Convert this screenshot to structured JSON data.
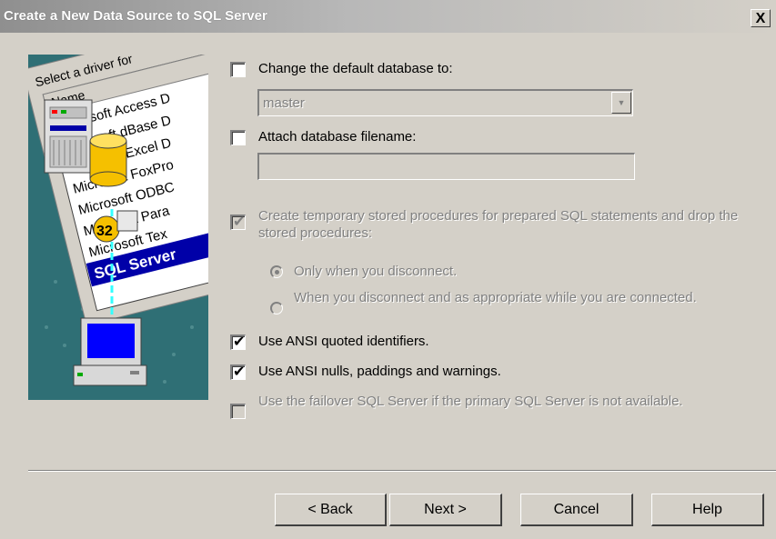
{
  "window": {
    "title": "Create a New Data Source to SQL Server",
    "close_label": "X"
  },
  "illustration": {
    "header_text": "Select a driver for",
    "column_label": "Name",
    "drivers": [
      "Microsoft Access D",
      "Microsoft dBase D",
      "Microsoft Excel D",
      "Microsoft FoxPro",
      "Microsoft ODBC",
      "Microsoft Para",
      "Microsoft Tex",
      "SQL Server"
    ],
    "badge": "32"
  },
  "options": {
    "change_default_db": {
      "label": "Change the default database to:",
      "checked": false
    },
    "default_db_value": "master",
    "attach_db": {
      "label": "Attach database filename:",
      "checked": false
    },
    "attach_db_value": "",
    "temp_procs": {
      "label": "Create temporary stored procedures for prepared SQL statements and drop the stored procedures:",
      "checked": true
    },
    "radio_disconnect": {
      "label": "Only when you disconnect.",
      "selected": true
    },
    "radio_appropriate": {
      "label": "When you disconnect and as appropriate while you are connected.",
      "selected": false
    },
    "ansi_quoted": {
      "label": "Use ANSI quoted identifiers.",
      "checked": true
    },
    "ansi_nulls": {
      "label": "Use ANSI nulls, paddings and warnings.",
      "checked": true
    },
    "failover": {
      "label": "Use the failover SQL Server if the primary SQL Server is not available.",
      "checked": false
    }
  },
  "buttons": {
    "back": "< Back",
    "next": "Next >",
    "cancel": "Cancel",
    "help": "Help"
  },
  "check_glyph": "✔"
}
